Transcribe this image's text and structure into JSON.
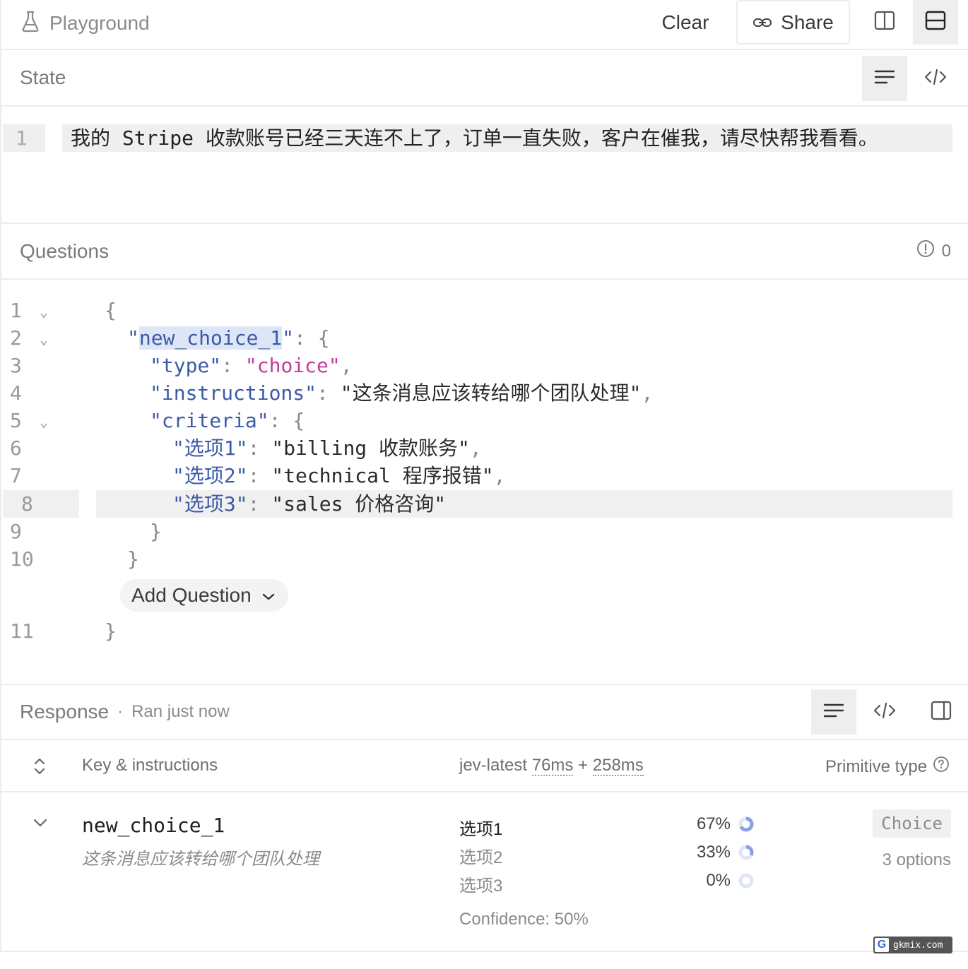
{
  "topbar": {
    "title": "Playground",
    "clear_label": "Clear",
    "share_label": "Share",
    "icons": [
      "flask-icon",
      "link-icon",
      "split-vertical-icon",
      "split-horizontal-icon"
    ]
  },
  "state": {
    "title": "State",
    "line_number": "1",
    "text": "我的 Stripe 收款账号已经三天连不上了，订单一直失败，客户在催我，请尽快帮我看看。"
  },
  "questions": {
    "title": "Questions",
    "error_count": "0",
    "line_numbers": [
      "1",
      "2",
      "3",
      "4",
      "5",
      "6",
      "7",
      "8",
      "9",
      "10",
      "11"
    ],
    "code": {
      "open_brace": "{",
      "key_quote_open": "\"",
      "key_name": "new_choice_1",
      "key_quote_close": "\"",
      "key_tail": ": {",
      "type_key": "\"type\"",
      "type_value": "\"choice\"",
      "instructions_key": "\"instructions\"",
      "instructions_value": "\"这条消息应该转给哪个团队处理\"",
      "criteria_key": "\"criteria\"",
      "criteria_tail": ": {",
      "opt1_key": "\"选项1\"",
      "opt1_value": "\"billing 收款账务\"",
      "opt2_key": "\"选项2\"",
      "opt2_value": "\"technical 程序报错\"",
      "opt3_key": "\"选项3\"",
      "opt3_value": "\"sales 价格咨询\"",
      "close_inner": "}",
      "close_mid": "}",
      "close_outer": "}"
    },
    "add_question_label": "Add Question"
  },
  "response": {
    "title": "Response",
    "status": "Ran just now",
    "columns": {
      "key_label": "Key & instructions",
      "model": "jev-latest",
      "time1": "76ms",
      "plus": "+",
      "time2": "258ms",
      "type_label": "Primitive type"
    },
    "row": {
      "key": "new_choice_1",
      "instructions": "这条消息应该转给哪个团队处理",
      "options": [
        {
          "label": "选项1",
          "percent": "67%",
          "value": 0.67
        },
        {
          "label": "选项2",
          "percent": "33%",
          "value": 0.33
        },
        {
          "label": "选项3",
          "percent": "0%",
          "value": 0
        }
      ],
      "confidence": "Confidence: 50%",
      "type_badge": "Choice",
      "options_count": "3 options"
    }
  },
  "watermark": {
    "badge": "G",
    "text": "gkmix.com"
  },
  "colors": {
    "accent": "#8aa0e0",
    "key": "#3b5aa6",
    "string": "#c43b9a"
  }
}
